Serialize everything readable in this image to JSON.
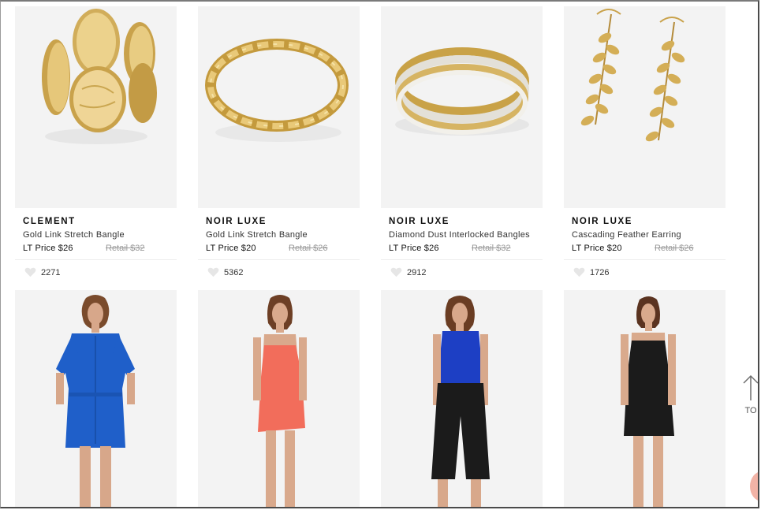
{
  "products_row1": [
    {
      "brand": "CLEMENT",
      "name": "Gold Link Stretch Bangle",
      "price": "LT Price $26",
      "retail": "Retail $32",
      "likes": "2271"
    },
    {
      "brand": "NOIR LUXE",
      "name": "Gold Link Stretch Bangle",
      "price": "LT Price $20",
      "retail": "Retail $26",
      "likes": "5362"
    },
    {
      "brand": "NOIR LUXE",
      "name": "Diamond Dust Interlocked Bangles",
      "price": "LT Price $26",
      "retail": "Retail $32",
      "likes": "2912"
    },
    {
      "brand": "NOIR LUXE",
      "name": "Cascading Feather Earring",
      "price": "LT Price $20",
      "retail": "Retail $26",
      "likes": "1726"
    }
  ],
  "scroll_top": {
    "label": "TO",
    "icon": "arrow-up-icon"
  },
  "colors": {
    "gold": "#d9b45a",
    "blue_dress": "#1f5fc9",
    "coral_dress": "#f26d5b",
    "royal_top": "#1d3fc4",
    "black": "#1b1b1b",
    "skin": "#d7a78a"
  }
}
